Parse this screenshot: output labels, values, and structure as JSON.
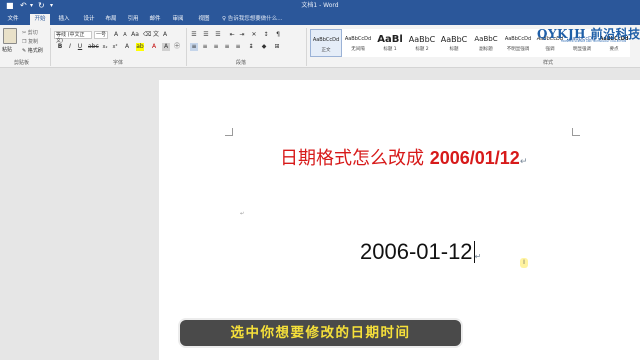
{
  "quick_access": {
    "save_icon": "save-icon",
    "undo_icon": "undo-icon",
    "redo_icon": "redo-icon",
    "customize_icon": "customize-icon"
  },
  "window_title": "文档1 - Word",
  "tabs": [
    {
      "label": "文件",
      "active": false
    },
    {
      "label": "开始",
      "active": true
    },
    {
      "label": "插入",
      "active": false
    },
    {
      "label": "设计",
      "active": false
    },
    {
      "label": "布局",
      "active": false
    },
    {
      "label": "引用",
      "active": false
    },
    {
      "label": "邮件",
      "active": false
    },
    {
      "label": "审阅",
      "active": false
    },
    {
      "label": "视图",
      "active": false
    }
  ],
  "tell_me": "告诉我您想要做什么...",
  "clipboard": {
    "paste_label": "粘贴",
    "cut_label": "剪切",
    "copy_label": "复制",
    "format_painter_label": "格式刷",
    "group_label": "剪贴板"
  },
  "font": {
    "name": "等线 (中文正文)",
    "size": "一号",
    "group_label": "字体"
  },
  "paragraph": {
    "group_label": "段落"
  },
  "styles": {
    "group_label": "样式",
    "items": [
      {
        "preview": "AaBbCcDd",
        "name": "正文",
        "selected": true
      },
      {
        "preview": "AaBbCcDd",
        "name": "无间隔",
        "selected": false
      },
      {
        "preview": "AaBl",
        "name": "标题 1",
        "selected": false
      },
      {
        "preview": "AaBbC",
        "name": "标题 2",
        "selected": false
      },
      {
        "preview": "AaBbC",
        "name": "标题",
        "selected": false
      },
      {
        "preview": "AaBbC",
        "name": "副标题",
        "selected": false
      },
      {
        "preview": "AaBbCcDd",
        "name": "不明显强调",
        "selected": false
      },
      {
        "preview": "AaBbCcDd",
        "name": "强调",
        "selected": false
      },
      {
        "preview": "AaBbCcDd",
        "name": "明显强调",
        "selected": false
      },
      {
        "preview": "AaBbCcDd",
        "name": "要点",
        "selected": false
      }
    ]
  },
  "watermark": {
    "main": "QYKJH 前沿科技汇",
    "sub": "FRONTIER SCIENCE AND TECHNOLOGY COLLECTION"
  },
  "document": {
    "heading_cn": "日期格式怎么改成",
    "heading_date": "2006/01/12",
    "date_text": "2006-01-12",
    "heading_color": "#d71a1a"
  },
  "caption": "选中你想要修改的日期时间",
  "colors": {
    "ribbon_blue": "#2b579a",
    "caption_text": "#f6e03a",
    "logo_blue": "#1f5fa8"
  }
}
